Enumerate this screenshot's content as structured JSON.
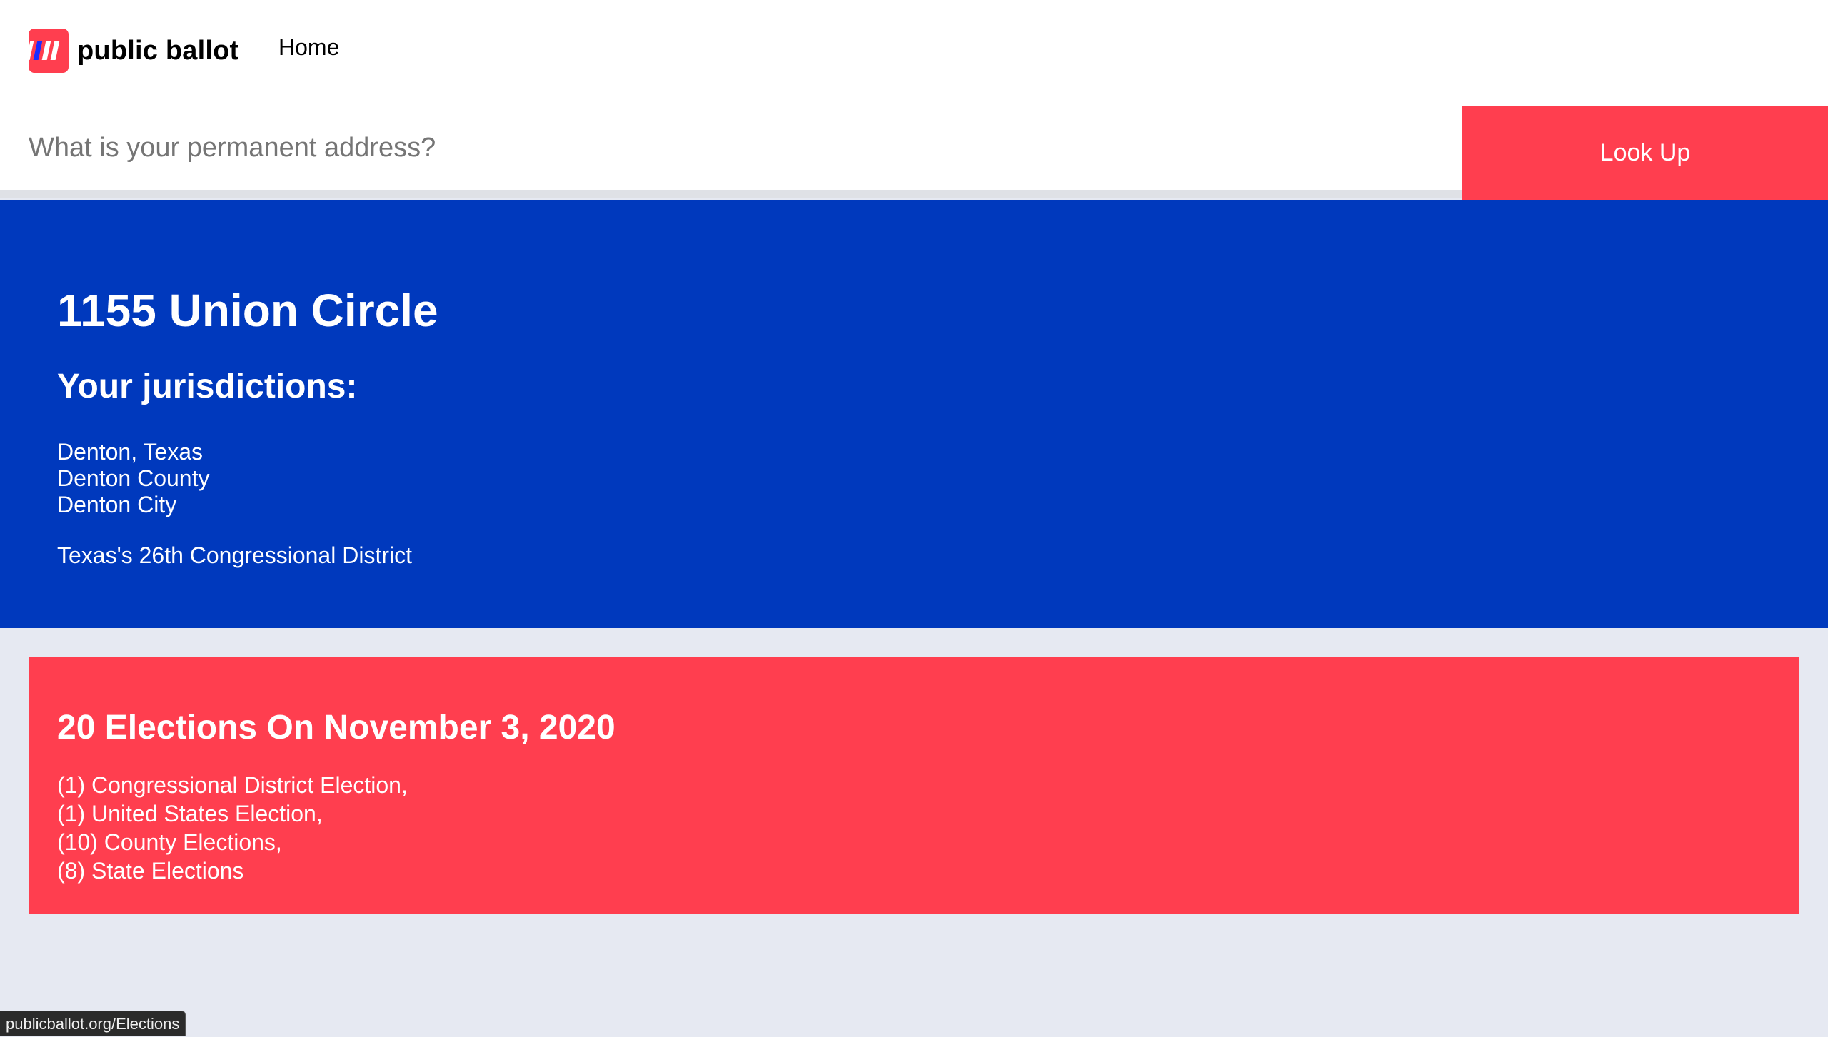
{
  "brand": {
    "name": "public ballot",
    "logo_color": "#ff3e4f"
  },
  "nav": {
    "home_label": "Home"
  },
  "search": {
    "value": "",
    "placeholder": "What is your permanent address?",
    "button_label": "Look Up"
  },
  "location": {
    "address": "1155 Union Circle",
    "jurisdictions_heading": "Your jurisdictions:",
    "jurisdictions": [
      "Denton, Texas",
      "Denton County",
      "Denton City"
    ],
    "district": "Texas's 26th Congressional District"
  },
  "elections": {
    "title": "20 Elections On November 3, 2020",
    "items": [
      "(1) Congressional District Election,",
      "(1) United States Election,",
      "(10) County Elections,",
      "(8) State Elections"
    ]
  },
  "status_bar": {
    "url": "publicballot.org/Elections"
  },
  "colors": {
    "hero_blue": "#0039bd",
    "accent_red": "#ff3e4f",
    "page_bg": "#e6e9f2"
  }
}
